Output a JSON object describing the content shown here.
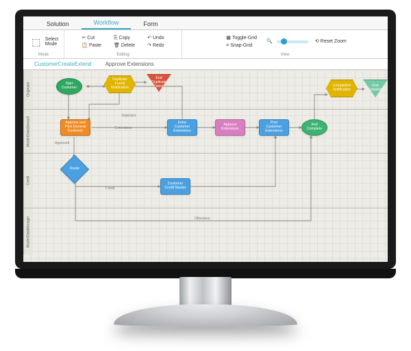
{
  "tabs": {
    "solution": "Solution",
    "workflow": "Workflow",
    "form": "Form",
    "active": "workflow"
  },
  "ribbon": {
    "mode": {
      "select": "Select\nMode",
      "group": "Mode"
    },
    "editing": {
      "cut": "Cut",
      "copy": "Copy",
      "paste": "Paste",
      "delete": "Delete",
      "undo": "Undo",
      "redo": "Redo",
      "group": "Editing"
    },
    "view": {
      "toggleGrid": "Toggle-Grid",
      "snapGrid": "Snap-Grid",
      "resetZoom": "Reset Zoom",
      "group": "View"
    }
  },
  "designTabs": {
    "tab1": "CustomerCreateExtend",
    "tab2": "Approve Extensions"
  },
  "lanes": {
    "l1": "Originator",
    "l2": "MasterDataSteward",
    "l3": "Credit",
    "l4": "MasterDataManager"
  },
  "nodes": {
    "start": "Start\nCustomer",
    "dupFound": "Duplicate\nFound\nNotification",
    "endDup": "End\nDuplicate\nCancel",
    "approvePost": "Approve and\nPost General\nCustomer",
    "enterExt": "Enter\nCustomer\nExtensions",
    "approveExt": "Approve\nExtensions",
    "postExt": "Post\nCustomer\nExtensions",
    "andComplete": "And\nComplete",
    "completeNotif": "Completion\nNotification",
    "endComplete": "End\ncomplete",
    "route": "Route",
    "credit": "Customer\nCredit Master"
  },
  "edges": {
    "rejected": "Rejected",
    "extensions": "Extensions",
    "approved": "Approved",
    "credit": "Credit",
    "otherwise": "Otherwise"
  },
  "colors": {
    "green": "#3cb371",
    "yellow": "#e0b400",
    "orange": "#f08a24",
    "red": "#d9533c",
    "blue": "#4aa0e0",
    "pink": "#d87fc2",
    "teal": "#72c9a3"
  }
}
